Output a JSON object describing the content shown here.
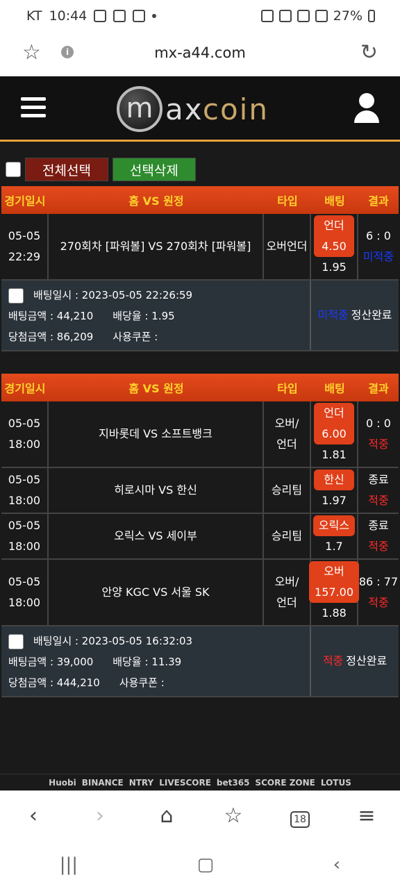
{
  "status_bar": {
    "carrier": "KT",
    "time": "10:44",
    "battery": "27%"
  },
  "browser": {
    "url": "mx-a44.com",
    "tab_count": "18"
  },
  "site": {
    "logo_m": "m",
    "logo_ax": "ax",
    "logo_coin": "coin"
  },
  "actions": {
    "select_all": "전체선택",
    "delete_selected": "선택삭제"
  },
  "table_headers": {
    "date": "경기일시",
    "match": "홈 VS 원정",
    "type": "타입",
    "bet": "배팅",
    "result": "결과"
  },
  "slips": [
    {
      "games": [
        {
          "date": "05-05",
          "time": "22:29",
          "match": "270회차 [파워볼]  VS  270회차 [파워볼]",
          "type": "오버언더",
          "pick": "언더",
          "pick_odds": "4.50",
          "odds": "1.95",
          "score": "6 : 0",
          "outcome": "미적중"
        }
      ],
      "bet_time_label": "배팅일시 : 2023-05-05 22:26:59",
      "amount_label": "배팅금액 : 44,210",
      "rate_label": "배당율 : 1.95",
      "win_label": "당첨금액 : 86,209",
      "coupon_label": "사용쿠폰 :",
      "outcome": "미적중",
      "settle": "정산완료"
    },
    {
      "games": [
        {
          "date": "05-05",
          "time": "18:00",
          "match": "지바롯데  VS  소프트뱅크",
          "type": "오버/ 언더",
          "pick": "언더",
          "pick_odds": "6.00",
          "odds": "1.81",
          "score": "0 : 0",
          "outcome": "적중"
        },
        {
          "date": "05-05",
          "time": "18:00",
          "match": "히로시마  VS  한신",
          "type": "승리팀",
          "pick": "한신",
          "pick_odds": "",
          "odds": "1.97",
          "score": "종료",
          "outcome": "적중"
        },
        {
          "date": "05-05",
          "time": "18:00",
          "match": "오릭스  VS  세이부",
          "type": "승리팀",
          "pick": "오릭스",
          "pick_odds": "",
          "odds": "1.7",
          "score": "종료",
          "outcome": "적중"
        },
        {
          "date": "05-05",
          "time": "18:00",
          "match": "안양 KGC  VS  서울 SK",
          "type": "오버/ 언더",
          "pick": "오버",
          "pick_odds": "157.00",
          "odds": "1.88",
          "score": "86 : 77",
          "outcome": "적중"
        }
      ],
      "bet_time_label": "배팅일시 : 2023-05-05 16:32:03",
      "amount_label": "배팅금액 : 39,000",
      "rate_label": "배당율 : 11.39",
      "win_label": "당첨금액 : 444,210",
      "coupon_label": "사용쿠폰 :",
      "outcome": "적중",
      "settle": "정산완료"
    }
  ],
  "partners": [
    "Huobi",
    "BINANCE",
    "NTRY",
    "LIVESCORE",
    "bet365",
    "SCORE ZONE",
    "LOTUS"
  ]
}
